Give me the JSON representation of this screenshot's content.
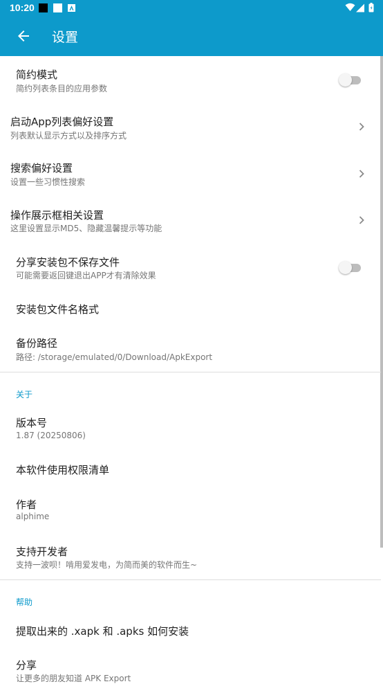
{
  "status_bar": {
    "time": "10:20"
  },
  "app_bar": {
    "title": "设置"
  },
  "settings": {
    "simple_mode": {
      "title": "简约模式",
      "subtitle": "简约列表条目的应用参数",
      "enabled": false
    },
    "launch_pref": {
      "title": "启动App列表偏好设置",
      "subtitle": "列表默认显示方式以及排序方式"
    },
    "search_pref": {
      "title": "搜索偏好设置",
      "subtitle": "设置一些习惯性搜索"
    },
    "action_pref": {
      "title": "操作展示框相关设置",
      "subtitle": "这里设置显示MD5、隐藏温馨提示等功能"
    },
    "share_no_save": {
      "title": "分享安装包不保存文件",
      "subtitle": "可能需要返回键退出APP才有清除效果",
      "enabled": false
    },
    "file_name_format": {
      "title": "安装包文件名格式"
    },
    "backup_path": {
      "title": "备份路径",
      "subtitle": "路径: /storage/emulated/0/Download/ApkExport"
    }
  },
  "about": {
    "header": "关于",
    "version": {
      "title": "版本号",
      "subtitle": "1.87 (20250806)"
    },
    "permissions": {
      "title": "本软件使用权限清单"
    },
    "author": {
      "title": "作者",
      "subtitle": "alphime"
    },
    "support": {
      "title": "支持开发者",
      "subtitle": "支持一波呗！啃用爱发电，为简而美的软件而生~"
    }
  },
  "help": {
    "header": "帮助",
    "install_guide": {
      "title": "提取出来的 .xapk 和 .apks 如何安装"
    },
    "share": {
      "title": "分享",
      "subtitle": "让更多的朋友知道 APK Export"
    }
  },
  "colors": {
    "accent": "#0d9acb",
    "primary_text": "#212121",
    "secondary_text": "#757575"
  },
  "icons": [
    "back-arrow-icon",
    "chevron-right-icon",
    "wifi-icon",
    "signal-icon",
    "battery-icon"
  ]
}
